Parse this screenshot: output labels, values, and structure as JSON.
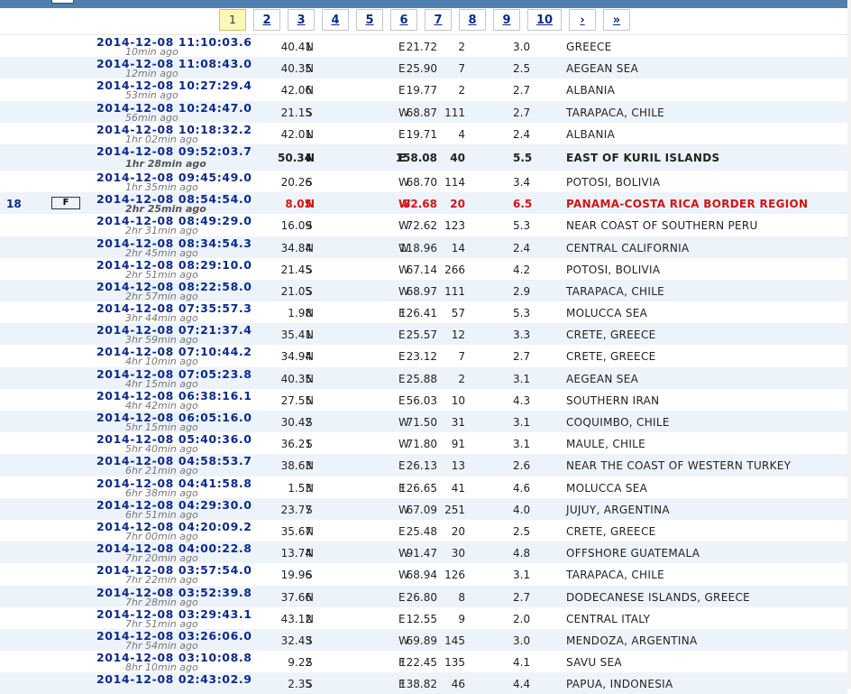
{
  "pagination": {
    "pages": [
      "1",
      "2",
      "3",
      "4",
      "5",
      "6",
      "7",
      "8",
      "9",
      "10"
    ],
    "active": "1",
    "next": "›",
    "last": "»"
  },
  "events": [
    {
      "dt": "2014-12-08   11:10:03.6",
      "ago": "10min ago",
      "lat": "40.41",
      "ns": "N",
      "lon": "21.72",
      "ew": "E",
      "depth": "2",
      "mag": "3.0",
      "region": "GREECE"
    },
    {
      "dt": "2014-12-08   11:08:43.0",
      "ago": "12min ago",
      "lat": "40.35",
      "ns": "N",
      "lon": "25.90",
      "ew": "E",
      "depth": "7",
      "mag": "2.5",
      "region": "AEGEAN SEA"
    },
    {
      "dt": "2014-12-08   10:27:29.4",
      "ago": "53min ago",
      "lat": "42.06",
      "ns": "N",
      "lon": "19.77",
      "ew": "E",
      "depth": "2",
      "mag": "2.7",
      "region": "ALBANIA"
    },
    {
      "dt": "2014-12-08   10:24:47.0",
      "ago": "56min ago",
      "lat": "21.15",
      "ns": "S",
      "lon": "68.87",
      "ew": "W",
      "depth": "111",
      "mag": "2.7",
      "region": "TARAPACA, CHILE"
    },
    {
      "dt": "2014-12-08   10:18:32.2",
      "ago": "1hr 02min ago",
      "lat": "42.01",
      "ns": "N",
      "lon": "19.71",
      "ew": "E",
      "depth": "4",
      "mag": "2.4",
      "region": "ALBANIA"
    },
    {
      "dt": "2014-12-08   09:52:03.7",
      "ago": "1hr 28min ago",
      "lat": "50.34",
      "ns": "N",
      "lon": "158.08",
      "ew": "E",
      "depth": "40",
      "mag": "5.5",
      "region": "EAST OF KURIL ISLANDS",
      "style": "bold"
    },
    {
      "dt": "2014-12-08   09:45:49.0",
      "ago": "1hr 35min ago",
      "lat": "20.26",
      "ns": "S",
      "lon": "68.70",
      "ew": "W",
      "depth": "114",
      "mag": "3.4",
      "region": "POTOSI, BOLIVIA"
    },
    {
      "dt": "2014-12-08   08:54:54.0",
      "ago": "2hr 25min ago",
      "lat": "8.05",
      "ns": "N",
      "lon": "82.68",
      "ew": "W",
      "depth": "20",
      "mag": "6.5",
      "region": "PANAMA-COSTA RICA BORDER REGION",
      "style": "red",
      "rank": "18",
      "flag": "F"
    },
    {
      "dt": "2014-12-08   08:49:29.0",
      "ago": "2hr 31min ago",
      "lat": "16.09",
      "ns": "S",
      "lon": "72.62",
      "ew": "W",
      "depth": "123",
      "mag": "5.3",
      "region": "NEAR COAST OF SOUTHERN PERU"
    },
    {
      "dt": "2014-12-08   08:34:54.3",
      "ago": "2hr 45min ago",
      "lat": "34.84",
      "ns": "N",
      "lon": "118.96",
      "ew": "W",
      "depth": "14",
      "mag": "2.4",
      "region": "CENTRAL CALIFORNIA"
    },
    {
      "dt": "2014-12-08   08:29:10.0",
      "ago": "2hr 51min ago",
      "lat": "21.45",
      "ns": "S",
      "lon": "67.14",
      "ew": "W",
      "depth": "266",
      "mag": "4.2",
      "region": "POTOSI, BOLIVIA"
    },
    {
      "dt": "2014-12-08   08:22:58.0",
      "ago": "2hr 57min ago",
      "lat": "21.05",
      "ns": "S",
      "lon": "68.97",
      "ew": "W",
      "depth": "111",
      "mag": "2.9",
      "region": "TARAPACA, CHILE"
    },
    {
      "dt": "2014-12-08   07:35:57.3",
      "ago": "3hr 44min ago",
      "lat": "1.98",
      "ns": "N",
      "lon": "126.41",
      "ew": "E",
      "depth": "57",
      "mag": "5.3",
      "region": "MOLUCCA SEA"
    },
    {
      "dt": "2014-12-08   07:21:37.4",
      "ago": "3hr 59min ago",
      "lat": "35.41",
      "ns": "N",
      "lon": "25.57",
      "ew": "E",
      "depth": "12",
      "mag": "3.3",
      "region": "CRETE, GREECE"
    },
    {
      "dt": "2014-12-08   07:10:44.2",
      "ago": "4hr 10min ago",
      "lat": "34.94",
      "ns": "N",
      "lon": "23.12",
      "ew": "E",
      "depth": "7",
      "mag": "2.7",
      "region": "CRETE, GREECE"
    },
    {
      "dt": "2014-12-08   07:05:23.8",
      "ago": "4hr 15min ago",
      "lat": "40.35",
      "ns": "N",
      "lon": "25.88",
      "ew": "E",
      "depth": "2",
      "mag": "3.1",
      "region": "AEGEAN SEA"
    },
    {
      "dt": "2014-12-08   06:38:16.1",
      "ago": "4hr 42min ago",
      "lat": "27.55",
      "ns": "N",
      "lon": "56.03",
      "ew": "E",
      "depth": "10",
      "mag": "4.3",
      "region": "SOUTHERN IRAN"
    },
    {
      "dt": "2014-12-08   06:05:16.0",
      "ago": "5hr 15min ago",
      "lat": "30.42",
      "ns": "S",
      "lon": "71.50",
      "ew": "W",
      "depth": "31",
      "mag": "3.1",
      "region": "COQUIMBO, CHILE"
    },
    {
      "dt": "2014-12-08   05:40:36.0",
      "ago": "5hr 40min ago",
      "lat": "36.21",
      "ns": "S",
      "lon": "71.80",
      "ew": "W",
      "depth": "91",
      "mag": "3.1",
      "region": "MAULE, CHILE"
    },
    {
      "dt": "2014-12-08   04:58:53.7",
      "ago": "6hr 21min ago",
      "lat": "38.63",
      "ns": "N",
      "lon": "26.13",
      "ew": "E",
      "depth": "13",
      "mag": "2.6",
      "region": "NEAR THE COAST OF WESTERN TURKEY"
    },
    {
      "dt": "2014-12-08   04:41:58.8",
      "ago": "6hr 38min ago",
      "lat": "1.53",
      "ns": "N",
      "lon": "126.65",
      "ew": "E",
      "depth": "41",
      "mag": "4.6",
      "region": "MOLUCCA SEA"
    },
    {
      "dt": "2014-12-08   04:29:30.0",
      "ago": "6hr 51min ago",
      "lat": "23.77",
      "ns": "S",
      "lon": "67.09",
      "ew": "W",
      "depth": "251",
      "mag": "4.0",
      "region": "JUJUY, ARGENTINA"
    },
    {
      "dt": "2014-12-08   04:20:09.2",
      "ago": "7hr 00min ago",
      "lat": "35.67",
      "ns": "N",
      "lon": "25.48",
      "ew": "E",
      "depth": "20",
      "mag": "2.5",
      "region": "CRETE, GREECE"
    },
    {
      "dt": "2014-12-08   04:00:22.8",
      "ago": "7hr 20min ago",
      "lat": "13.74",
      "ns": "N",
      "lon": "91.47",
      "ew": "W",
      "depth": "30",
      "mag": "4.8",
      "region": "OFFSHORE GUATEMALA"
    },
    {
      "dt": "2014-12-08   03:57:54.0",
      "ago": "7hr 22min ago",
      "lat": "19.96",
      "ns": "S",
      "lon": "68.94",
      "ew": "W",
      "depth": "126",
      "mag": "3.1",
      "region": "TARAPACA, CHILE"
    },
    {
      "dt": "2014-12-08   03:52:39.8",
      "ago": "7hr 28min ago",
      "lat": "37.66",
      "ns": "N",
      "lon": "26.80",
      "ew": "E",
      "depth": "8",
      "mag": "2.7",
      "region": "DODECANESE ISLANDS, GREECE"
    },
    {
      "dt": "2014-12-08   03:29:43.1",
      "ago": "7hr 51min ago",
      "lat": "43.12",
      "ns": "N",
      "lon": "12.55",
      "ew": "E",
      "depth": "9",
      "mag": "2.0",
      "region": "CENTRAL ITALY"
    },
    {
      "dt": "2014-12-08   03:26:06.0",
      "ago": "7hr 54min ago",
      "lat": "32.43",
      "ns": "S",
      "lon": "69.89",
      "ew": "W",
      "depth": "145",
      "mag": "3.0",
      "region": "MENDOZA, ARGENTINA"
    },
    {
      "dt": "2014-12-08   03:10:08.8",
      "ago": "8hr 10min ago",
      "lat": "9.22",
      "ns": "S",
      "lon": "122.45",
      "ew": "E",
      "depth": "135",
      "mag": "4.1",
      "region": "SAVU SEA"
    },
    {
      "dt": "2014-12-08   02:43:02.9",
      "ago": "",
      "lat": "2.35",
      "ns": "S",
      "lon": "138.82",
      "ew": "E",
      "depth": "46",
      "mag": "4.4",
      "region": "PAPUA, INDONESIA"
    }
  ]
}
